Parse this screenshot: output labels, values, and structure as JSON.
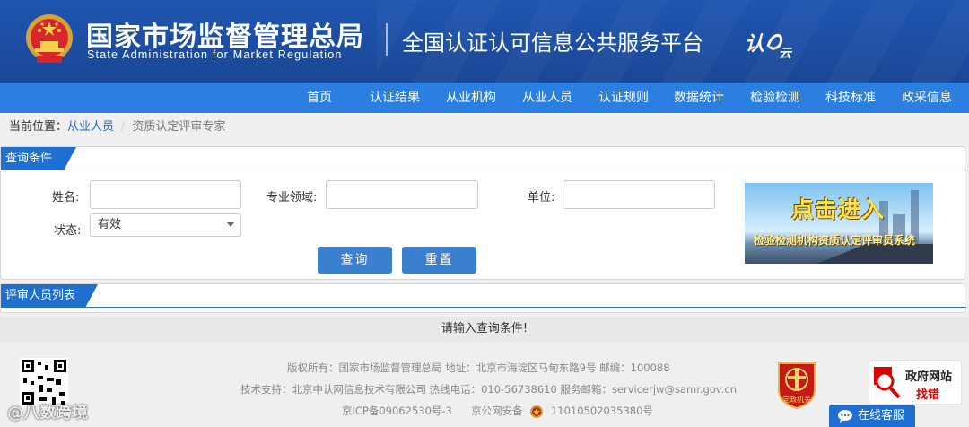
{
  "header": {
    "agency_cn": "国家市场监督管理总局",
    "agency_en": "State Administration  for  Market Regulation",
    "platform_title": "全国认证认可信息公共服务平台",
    "platform_logo": "认证云",
    "bg_color": "#1c4a9c"
  },
  "nav": {
    "bg_color": "#2b7fe0",
    "items": [
      "首页",
      "认证结果",
      "从业机构",
      "从业人员",
      "认证规则",
      "数据统计",
      "检验检测",
      "科技标准",
      "政采信息"
    ]
  },
  "breadcrumb": {
    "label": "当前位置：",
    "parent": "从业人员",
    "separator": "/",
    "current": "资质认定评审专家"
  },
  "query": {
    "title": "查询条件",
    "name_label": "姓名:",
    "field_label": "专业领域:",
    "unit_label": "单位:",
    "status_label": "状态:",
    "status_value": "有效",
    "search_button": "查询",
    "reset_button": "重置",
    "banner_main": "点击进入",
    "banner_sub": "检验检测机构资质认定评审员系统"
  },
  "list": {
    "title": "评审人员列表",
    "empty_message": "请输入查询条件!"
  },
  "footer": {
    "line1": "版权所有：国家市场监督管理总局    地址：北京市海淀区马甸东路9号    邮编：100088",
    "line2": "技术支持：北京中认网信息技术有限公司    热线电话：010-56738610    服务邮箱：servicerjw@samr.gov.cn",
    "icp": "京ICP备09062530号-3",
    "police_label": "京公网安备",
    "police_number": "11010502035380号",
    "party_badge": "党政机关",
    "gov_findbug_line1": "政府网站",
    "gov_findbug_line2": "找错",
    "online_service": "在线客服",
    "watermark": "@八数跨境"
  }
}
